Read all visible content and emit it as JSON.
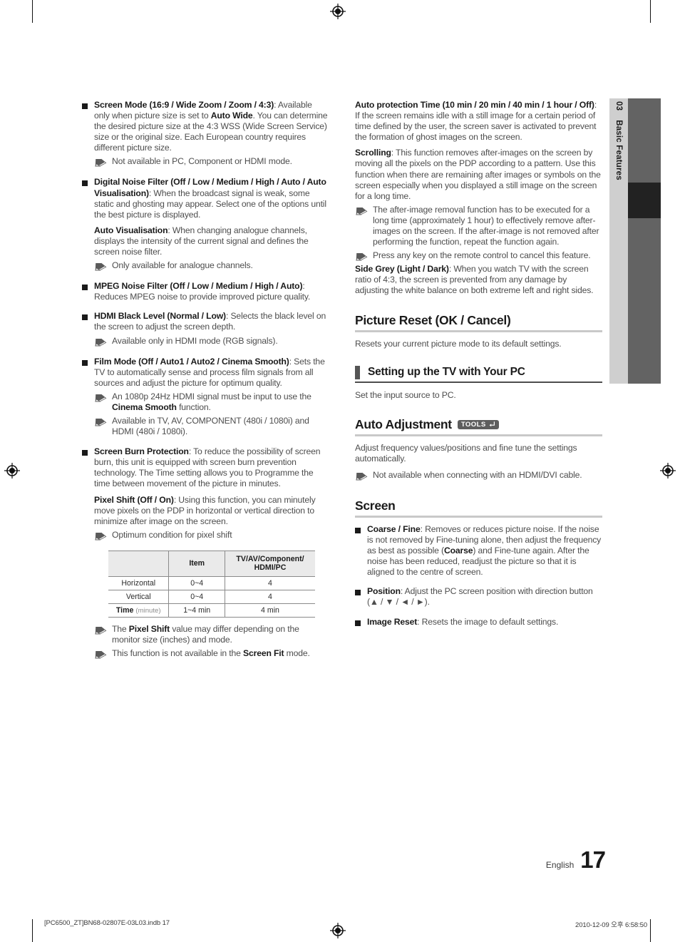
{
  "page": {
    "number": "17",
    "language_label": "English",
    "chapter_number": "03",
    "chapter_title": "Basic Features"
  },
  "footer": {
    "file": "[PC6500_ZT]BN68-02807E-03L03.indb   17",
    "timestamp": "2010-12-09   오후 6:58:50"
  },
  "left_column": {
    "items": [
      {
        "title": "Screen Mode (16:9 / Wide Zoom / Zoom / 4:3)",
        "body_1a": ": Available only when picture size is set to ",
        "body_1b": "Auto Wide",
        "body_1c": ". You can determine the desired picture size at the 4:3 WSS (Wide Screen Service) size or the original size. Each European country requires different picture size.",
        "note_1": "Not available in PC, Component or HDMI mode."
      },
      {
        "title_a": "Digital Noise Filter (Off / Low / Medium / High / Auto / Auto Visualisation)",
        "body_1": ": When the broadcast signal is weak, some static and ghosting may appear. Select one of the options until the best picture is displayed.",
        "sub_title": "Auto Visualisation",
        "body_2": ": When changing analogue channels, displays the intensity of the current signal and defines the screen noise filter.",
        "note_1": "Only available for analogue channels."
      },
      {
        "title": "MPEG Noise Filter (Off / Low / Medium / High / Auto)",
        "body_1": ": Reduces MPEG noise to provide improved picture quality."
      },
      {
        "title": "HDMI Black Level (Normal / Low)",
        "body_1": ": Selects the black level on the screen to adjust the screen depth.",
        "note_1": "Available only in HDMI mode (RGB signals)."
      },
      {
        "title": "Film Mode (Off / Auto1 / Auto2 / Cinema Smooth)",
        "body_1": ": Sets the TV to automatically sense and process film signals from all sources and adjust the picture for optimum quality.",
        "note_1a": "An 1080p 24Hz HDMI signal must be input to use the ",
        "note_1b": "Cinema Smooth",
        "note_1c": " function.",
        "note_2": "Available in TV, AV, COMPONENT (480i / 1080i) and HDMI (480i / 1080i)."
      },
      {
        "title": "Screen Burn Protection",
        "body_1": ": To reduce the possibility of screen burn, this unit is equipped with screen burn prevention technology. The Time setting allows you to Programme the time between movement of the picture in minutes.",
        "sub_title": "Pixel Shift (Off / On)",
        "body_2": ": Using this function, you can minutely move pixels on the PDP in horizontal or vertical direction to minimize after image on the screen.",
        "note_1": "Optimum condition for pixel shift",
        "note_2a": "The ",
        "note_2b": "Pixel Shift",
        "note_2c": " value may differ depending on the monitor size (inches) and mode.",
        "note_3a": "This function is not available in the ",
        "note_3b": "Screen Fit",
        "note_3c": " mode."
      }
    ],
    "pixel_shift_table": {
      "headers": [
        "",
        "Item",
        "TV/AV/Component/\nHDMI/PC"
      ],
      "header_item": "Item",
      "header_mode_line1": "TV/AV/Component/",
      "header_mode_line2": "HDMI/PC",
      "rows": [
        {
          "label": "Horizontal",
          "label_suffix": "",
          "item": "0~4",
          "mode": "4"
        },
        {
          "label": "Vertical",
          "label_suffix": "",
          "item": "0~4",
          "mode": "4"
        },
        {
          "label": "Time",
          "label_suffix": "(minute)",
          "item": "1~4 min",
          "mode": "4 min"
        }
      ]
    }
  },
  "right_column": {
    "blocks": [
      {
        "title": "Auto protection Time (10 min / 20 min / 40 min / 1 hour / Off)",
        "body": ": If the screen remains idle with a still image for a certain period of time defined by the user, the screen saver is activated to prevent the formation of ghost images on the screen."
      },
      {
        "title": "Scrolling",
        "body": ": This function removes after-images on the screen by moving all the pixels on the PDP according to a pattern. Use this function when there are remaining after images or symbols on the screen especially when you displayed a still image on the screen for a long time.",
        "note_1": "The after-image removal function has to be executed for a long time (approximately 1 hour) to effectively remove after-images on the screen. If the after-image is not removed after performing the function, repeat the function again.",
        "note_2": "Press any key on the remote control to cancel this feature."
      },
      {
        "title": "Side Grey (Light / Dark)",
        "body": ": When you watch TV with the screen ratio of 4:3, the screen is prevented from any damage by adjusting the white balance on both extreme left and right sides."
      }
    ],
    "picture_reset": {
      "heading": "Picture Reset (OK / Cancel)",
      "body": "Resets your current picture mode to its default settings."
    },
    "setting_up_pc": {
      "heading": "Setting up the TV with Your PC",
      "body": "Set the input source to PC."
    },
    "auto_adjustment": {
      "heading": "Auto Adjustment",
      "badge": "TOOLS",
      "body": "Adjust frequency values/positions and fine tune the settings automatically.",
      "note_1": "Not available when connecting with an HDMI/DVI cable."
    },
    "screen": {
      "heading": "Screen",
      "items": [
        {
          "title": "Coarse / Fine",
          "body_a": ": Removes or reduces picture noise. If the noise is not removed by Fine-tuning alone, then adjust the frequency as best as possible (",
          "body_b": "Coarse",
          "body_c": ") and Fine-tune again. After the noise has been reduced, readjust the picture so that it is aligned to the centre of screen."
        },
        {
          "title": "Position",
          "body": ": Adjust the PC screen position with direction button (▲ / ▼ / ◄ / ►)."
        },
        {
          "title": "Image Reset",
          "body": ": Resets the image to default settings."
        }
      ]
    }
  }
}
